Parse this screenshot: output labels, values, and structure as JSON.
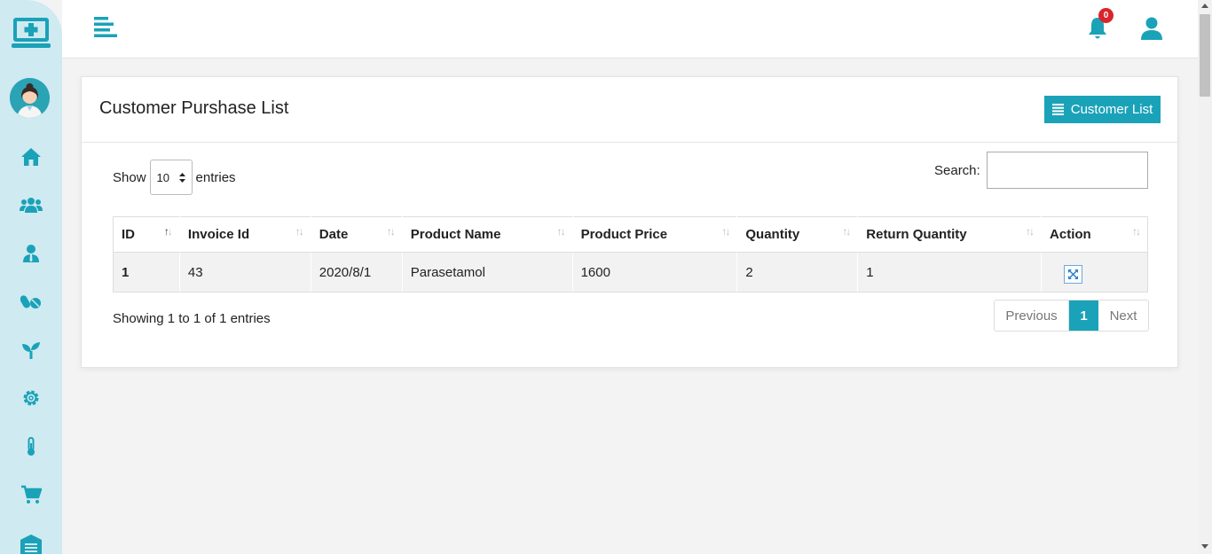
{
  "topbar": {
    "notification_count": "0"
  },
  "card": {
    "title": "Customer Purshase List",
    "customer_list_button": "Customer List"
  },
  "table_controls": {
    "show_label": "Show",
    "entries_value": "10",
    "entries_label": "entries",
    "search_label": "Search:",
    "search_value": ""
  },
  "table": {
    "headers": [
      "ID",
      "Invoice Id",
      "Date",
      "Product Name",
      "Product Price",
      "Quantity",
      "Return Quantity",
      "Action"
    ],
    "rows": [
      {
        "id": "1",
        "invoice_id": "43",
        "date": "2020/8/1",
        "product_name": "Parasetamol",
        "product_price": "1600",
        "quantity": "2",
        "return_quantity": "1"
      }
    ]
  },
  "footer": {
    "info": "Showing 1 to 1 of 1 entries",
    "previous": "Previous",
    "current_page": "1",
    "next": "Next"
  },
  "colors": {
    "accent": "#1aa2b8",
    "sidebar_bg": "#cfeaf1",
    "badge": "#d9242b"
  },
  "icons": {
    "sidebar": [
      "logo-monitor-plus-icon",
      "doctor-avatar",
      "home-icon",
      "users-icon",
      "user-tie-icon",
      "pills-icon",
      "seedling-icon",
      "gear-icon",
      "thermometer-icon",
      "cart-icon",
      "warehouse-icon"
    ],
    "topbar": [
      "menu-toggle-icon",
      "bell-icon",
      "user-icon"
    ]
  }
}
